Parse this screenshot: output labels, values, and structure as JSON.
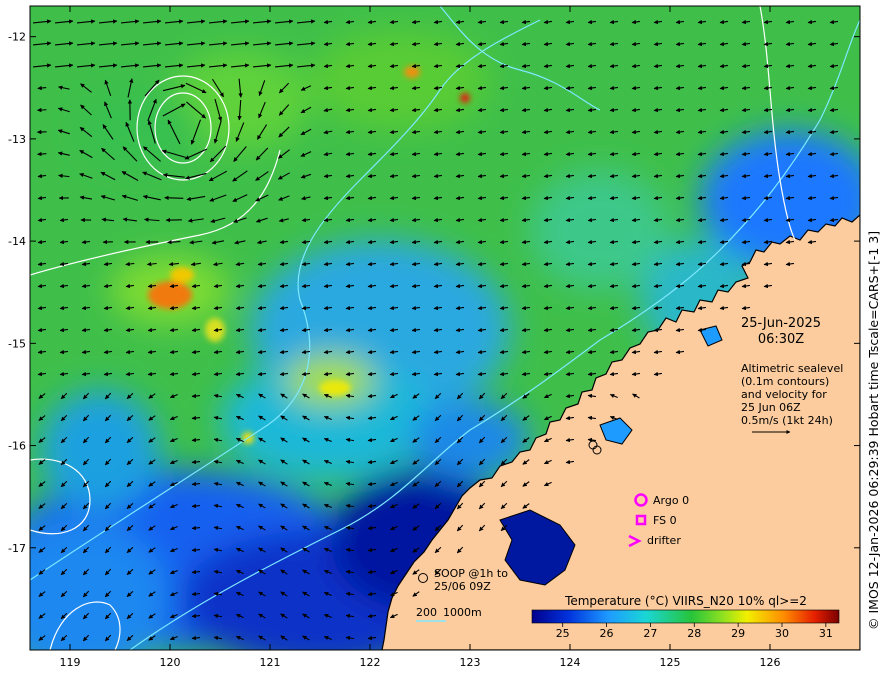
{
  "map": {
    "date": "25-Jun-2025",
    "time": "06:30Z",
    "description": [
      "Altimetric sealevel",
      "(0.1m contours)",
      "and velocity for",
      "25 Jun 06Z"
    ],
    "velocity_scale_label": "0.5m/s (1kt 24h)",
    "soop_label": [
      "SOOP @1h to",
      "25/06 09Z"
    ],
    "contour_legend": [
      "200",
      "1000m"
    ]
  },
  "legend": {
    "argo": "Argo 0",
    "fs": "FS 0",
    "drifter": "drifter",
    "marker_color": "#ff00ff"
  },
  "colorbar": {
    "title": "Temperature (°C) VIIRS_N20 10% ql>=2",
    "ticks": [
      "25",
      "26",
      "27",
      "28",
      "29",
      "30",
      "31"
    ],
    "min": 24.3,
    "max": 31.3
  },
  "axes": {
    "lon_ticks": [
      "119",
      "120",
      "121",
      "122",
      "123",
      "124",
      "125",
      "126"
    ],
    "lat_ticks": [
      "-12",
      "-13",
      "-14",
      "-15",
      "-16",
      "-17"
    ],
    "lon_range": [
      118.6,
      126.9
    ],
    "lat_range": [
      -11.7,
      -18.0
    ]
  },
  "credit": "© IMOS 12-Jan-2026 06:29:39 Hobart time Tscale=CARS+[-1 3]",
  "colors": {
    "land": "#fccc9e",
    "deep_water": "#00008c",
    "contour": "#7ee8ff",
    "sealevel_contour": "#ffffff"
  }
}
